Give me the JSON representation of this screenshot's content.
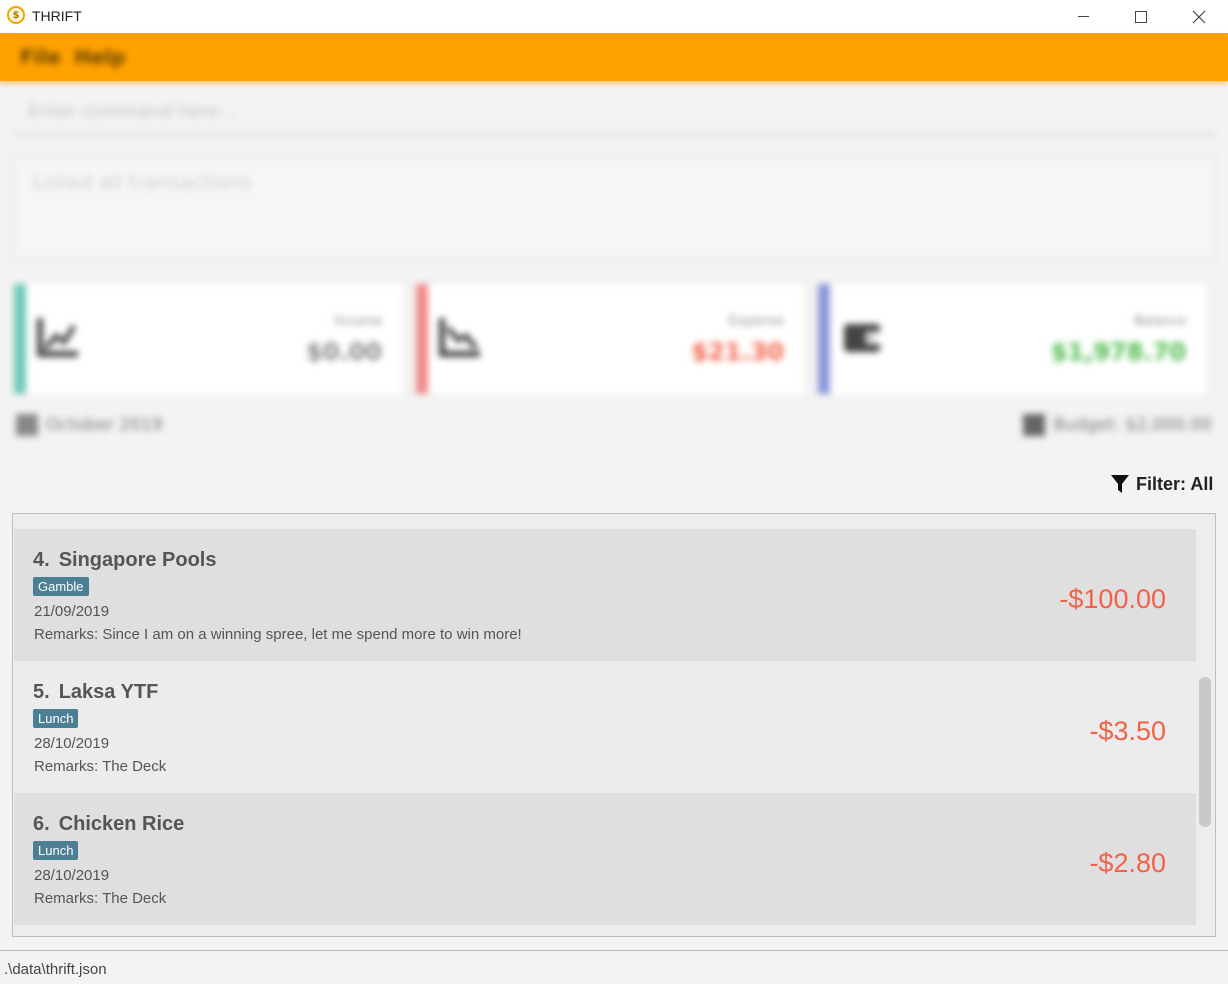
{
  "window": {
    "title": "THRIFT",
    "icon": "thrift-logo-icon"
  },
  "menu": {
    "items": [
      {
        "label": "File"
      },
      {
        "label": "Help"
      }
    ],
    "color": "#ffa200"
  },
  "command": {
    "placeholder": "Enter command here..."
  },
  "result": {
    "text": "Listed all transactions"
  },
  "stats": {
    "income": {
      "label": "Income",
      "value": "$0.00",
      "bar_color": "#6fc9b8",
      "icon": "income-chart-icon"
    },
    "expense": {
      "label": "Expense",
      "value": "$21.30",
      "bar_color": "#ef8a8a",
      "icon": "expense-chart-icon",
      "value_color": "#f26148"
    },
    "balance": {
      "label": "Balance",
      "value": "$1,978.70",
      "bar_color": "#8b95d9",
      "icon": "wallet-icon",
      "value_color": "#4cbb4c"
    }
  },
  "summary": {
    "period": "October 2019",
    "budget": "Budget: $2,000.00"
  },
  "filter": {
    "label": "Filter: All",
    "icon": "filter-icon"
  },
  "transactions": [
    {
      "index": "4.",
      "name": "Singapore Pools",
      "tag": "Gamble",
      "date": "21/09/2019",
      "remarks": "Remarks: Since I am on a winning spree, let me spend more to win more!",
      "amount": "-$100.00"
    },
    {
      "index": "5.",
      "name": "Laksa YTF",
      "tag": "Lunch",
      "date": "28/10/2019",
      "remarks": "Remarks: The Deck",
      "amount": "-$3.50"
    },
    {
      "index": "6.",
      "name": "Chicken Rice",
      "tag": "Lunch",
      "date": "28/10/2019",
      "remarks": "Remarks: The Deck",
      "amount": "-$2.80"
    }
  ],
  "status": {
    "path": ".\\data\\thrift.json"
  }
}
